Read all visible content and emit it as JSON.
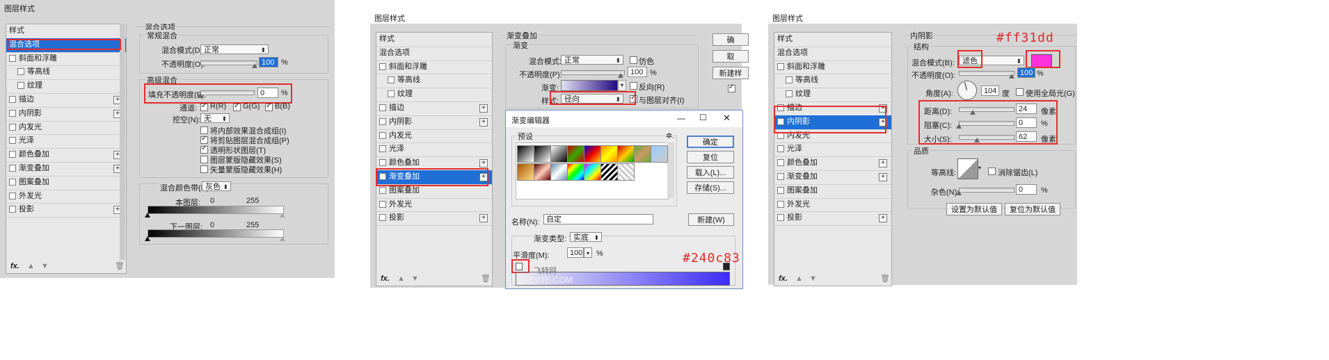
{
  "p1": {
    "window_title": "图层样式",
    "list": [
      "样式",
      "混合选项",
      "斜面和浮雕",
      "等高线",
      "纹理",
      "描边",
      "内阴影",
      "内发光",
      "光泽",
      "颜色叠加",
      "渐变叠加",
      "图案叠加",
      "外发光",
      "投影"
    ],
    "selected_index": 1,
    "blend_options_title": "混合选项",
    "general_blend_title": "常规混合",
    "blend_mode_label": "混合模式(D):",
    "blend_mode_value": "正常",
    "opacity_label": "不透明度(O):",
    "opacity_value": "100",
    "percent": "%",
    "advanced_blend_title": "高级混合",
    "fill_opacity_label": "填充不透明度(F):",
    "fill_opacity_value": "0",
    "channels_label": "通道:",
    "channel_r": "R(R)",
    "channel_g": "G(G)",
    "channel_b": "B(B)",
    "knockout_label": "挖空(N):",
    "knockout_value": "无",
    "chk1": "将内部效果混合成组(I)",
    "chk2": "将剪贴图层混合成组(P)",
    "chk3": "透明形状图层(T)",
    "chk4": "图层蒙版隐藏效果(S)",
    "chk5": "矢量蒙版隐藏效果(H)",
    "blend_if_label": "混合颜色带(E):",
    "blend_if_value": "灰色",
    "this_layer_label": "本图层:",
    "under_layer_label": "下一图层:",
    "v0": "0",
    "v255": "255",
    "fx": "fx."
  },
  "p2": {
    "window_title": "图层样式",
    "list": [
      "样式",
      "混合选项",
      "斜面和浮雕",
      "等高线",
      "纹理",
      "描边",
      "内阴影",
      "内发光",
      "光泽",
      "颜色叠加",
      "渐变叠加",
      "图案叠加",
      "外发光",
      "投影"
    ],
    "selected_index": 10,
    "section_title": "渐变叠加",
    "sub_title": "渐变",
    "blend_mode_label": "混合模式:",
    "blend_mode_value": "正常",
    "dither_label": "仿色",
    "opacity_label": "不透明度(P):",
    "opacity_value": "100",
    "percent": "%",
    "gradient_label": "渐变:",
    "reverse_label": "反向(R)",
    "style_label": "样式:",
    "style_value": "径向",
    "align_label": "与图层对齐(I)",
    "right_buttons": [
      "确",
      "取",
      "新建样"
    ],
    "fx": "fx."
  },
  "editor": {
    "title": "渐变编辑器",
    "presets_label": "预设",
    "gear": "✲.",
    "ok": "确定",
    "reset": "复位",
    "load": "载入(L)...",
    "save": "存储(S)...",
    "name_label": "名称(N):",
    "name_value": "自定",
    "new_button": "新建(W)",
    "type_label": "渐变类型:",
    "type_value": "实底",
    "smooth_label": "平滑度(M):",
    "smooth_value": "100",
    "percent": "%",
    "annotation": "#240c83",
    "watermark_a": "飞特网",
    "watermark_b": "FEVTE.COM",
    "ctrl_min": "—",
    "ctrl_max": "☐",
    "ctrl_close": "✕",
    "colors": {
      "stop_end": "#240c83"
    }
  },
  "p3": {
    "window_title": "图层样式",
    "list": [
      "样式",
      "混合选项",
      "斜面和浮雕",
      "等高线",
      "纹理",
      "描边",
      "内阴影",
      "内发光",
      "光泽",
      "颜色叠加",
      "渐变叠加",
      "图案叠加",
      "外发光",
      "投影"
    ],
    "selected_index": 6,
    "section_title": "内阴影",
    "structure_title": "结构",
    "blend_mode_label": "混合模式(B):",
    "blend_mode_value": "滤色",
    "opacity_label": "不透明度(O):",
    "opacity_value": "100",
    "percent": "%",
    "angle_label": "角度(A):",
    "angle_value": "104",
    "degree": "度",
    "global_light_label": "使用全局光(G)",
    "distance_label": "距离(D):",
    "distance_value": "24",
    "choke_label": "阻塞(C):",
    "choke_value": "0",
    "size_label": "大小(S):",
    "size_value": "62",
    "px": "像素",
    "quality_title": "品质",
    "contour_label": "等高线:",
    "antialias_label": "消除锯齿(L)",
    "noise_label": "杂色(N):",
    "noise_value": "0",
    "default_btn": "设置为默认值",
    "reset_btn": "复位为默认值",
    "annotation": "#ff31dd",
    "fx": "fx.",
    "colors": {
      "shadow": "#ff31dd"
    }
  }
}
